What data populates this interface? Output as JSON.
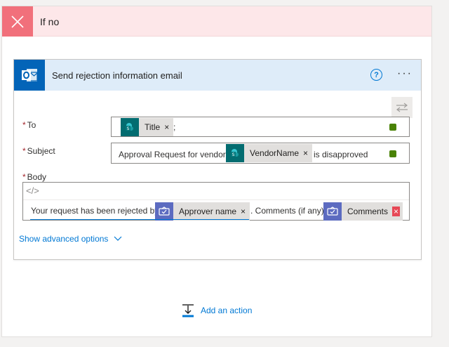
{
  "branch": {
    "title": "If no"
  },
  "action": {
    "title": "Send rejection information email",
    "help_glyph": "?",
    "more_glyph": "···",
    "app_icon": "outlook-icon"
  },
  "fields": {
    "to": {
      "label": "To",
      "required_mark": "*",
      "token": "Title",
      "token_remove": "×",
      "trailing_text": ";"
    },
    "subject": {
      "label": "Subject",
      "required_mark": "*",
      "prefix_text": "Approval Request for vendor",
      "token": "VendorName",
      "token_remove": "×",
      "suffix_text": "is disapproved"
    },
    "body": {
      "label": "Body",
      "required_mark": "*",
      "code_glyph": "</>",
      "prefix_text": "Your request has been rejected by",
      "token1": "Approver name",
      "token1_remove": "×",
      "middle_text": ". Comments (if any):",
      "token2": "Comments",
      "token2_remove": "×"
    }
  },
  "advanced_options_label": "Show advanced options",
  "add_action_label": "Add an action",
  "colors": {
    "branch_header": "#fde7e9",
    "branch_close": "#f1707b",
    "card_header": "#deecf9",
    "outlook_blue": "#0364b8",
    "sharepoint_teal": "#036c70",
    "approvals_purple": "#5c6bc0",
    "link_blue": "#0078d4",
    "valid_green": "#498205",
    "error_red": "#e74856"
  }
}
